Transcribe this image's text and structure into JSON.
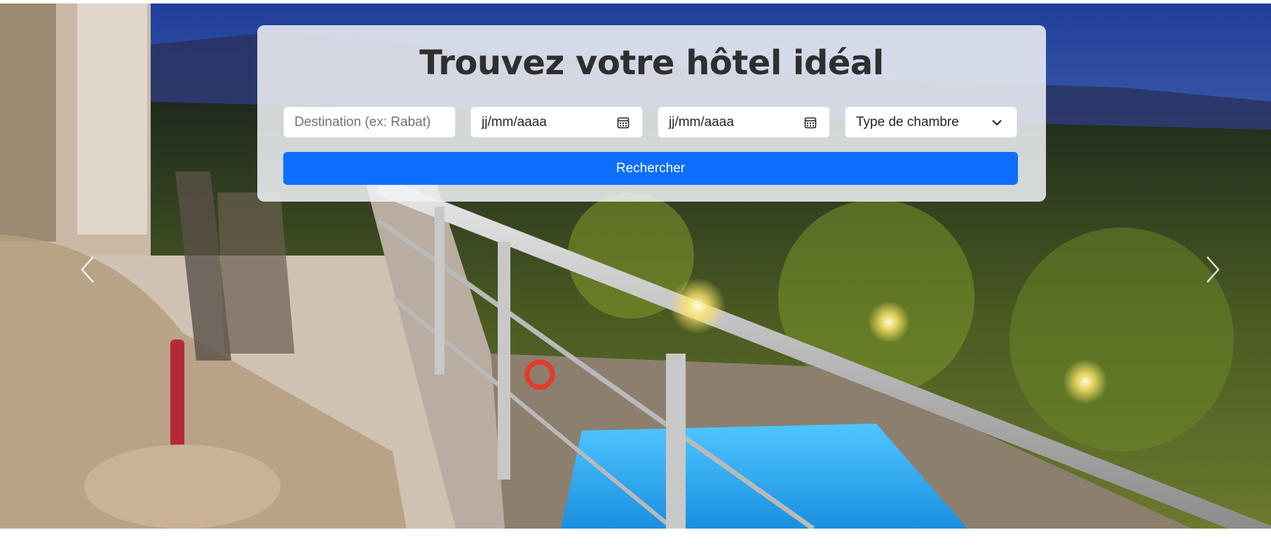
{
  "hero": {
    "image_icon": "hotel-balcony-pool-photo",
    "prev_icon": "chevron-left-icon",
    "next_icon": "chevron-right-icon"
  },
  "search": {
    "title": "Trouvez votre hôtel idéal",
    "destination_placeholder": "Destination (ex: Rabat)",
    "checkin_placeholder": "jj/mm/aaaa",
    "checkout_placeholder": "jj/mm/aaaa",
    "room_type_selected": "Type de chambre",
    "button_label": "Rechercher"
  },
  "colors": {
    "primary": "#0d6efd",
    "title": "#2f2f2f",
    "card_bg": "#f0f2f6"
  }
}
